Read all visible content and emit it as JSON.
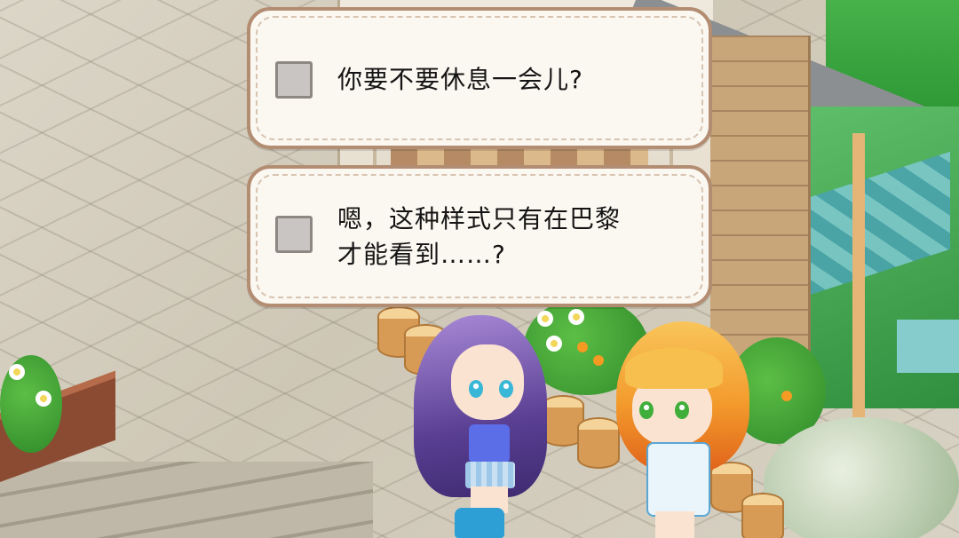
{
  "dialog": {
    "choices": [
      {
        "text": "你要不要休息一会儿?"
      },
      {
        "text": "嗯，这种样式只有在巴黎\n才能看到……?"
      }
    ]
  },
  "colors": {
    "dialog_background": "#fbf7f1",
    "dialog_border": "#b38d72",
    "checkbox_fill": "#c9c5c2",
    "text": "#141414"
  },
  "scene": {
    "characters": [
      "purple-haired-girl",
      "blonde-haired-girl"
    ]
  }
}
